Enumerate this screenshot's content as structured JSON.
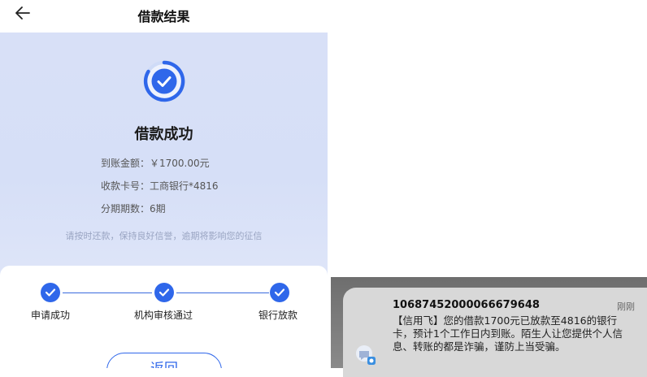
{
  "header": {
    "title": "借款结果"
  },
  "result": {
    "title": "借款成功",
    "amount_label": "到账金额：",
    "amount_value": "￥1700.00元",
    "card_label": "收款卡号：",
    "card_value": "工商银行*4816",
    "term_label": "分期期数：",
    "term_value": "6期",
    "hint": "请按时还款，保持良好信誉，逾期将影响您的征信"
  },
  "steps": [
    {
      "label": "申请成功",
      "done": true
    },
    {
      "label": "机构审核通过",
      "done": true
    },
    {
      "label": "银行放款",
      "done": true
    }
  ],
  "return_button": {
    "label": "返回"
  },
  "notification": {
    "sender": "10687452000066679648",
    "time": "刚刚",
    "body": "【信用飞】您的借款1700元已放款至4816的银行卡，预计1个工作日内到账。陌生人让您提供个人信息、转账的都是诈骗，谨防上当受骗。"
  },
  "colors": {
    "accent": "#2f67ea",
    "hero_bg": "#d8e0f7"
  }
}
